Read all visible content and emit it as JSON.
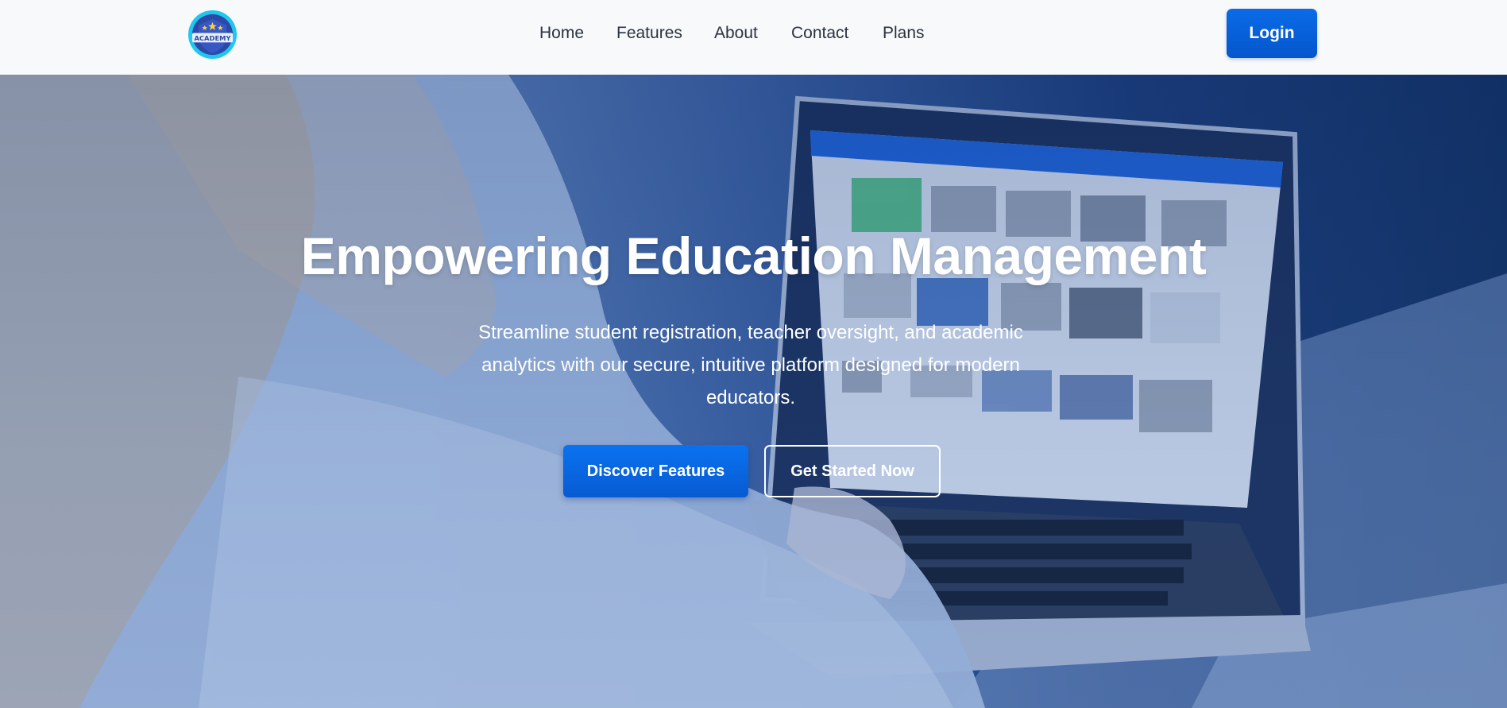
{
  "header": {
    "logo_text": "ACADEMY",
    "nav": [
      {
        "label": "Home"
      },
      {
        "label": "Features"
      },
      {
        "label": "About"
      },
      {
        "label": "Contact"
      },
      {
        "label": "Plans"
      }
    ],
    "login_label": "Login"
  },
  "hero": {
    "title": "Empowering Education Management",
    "subtitle": "Streamline student registration, teacher oversight, and academic analytics with our secure, intuitive platform designed for modern educators.",
    "primary_cta": "Discover Features",
    "secondary_cta": "Get Started Now"
  },
  "colors": {
    "brand_blue": "#0a6be8",
    "nav_text": "#2b3340",
    "hero_overlay": "#1e4a90"
  }
}
